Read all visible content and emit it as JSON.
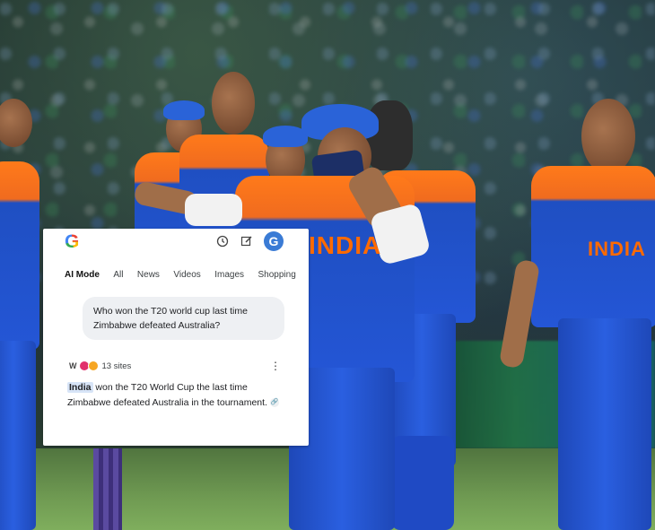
{
  "background": {
    "jersey_wordmark": "INDIA",
    "colors": {
      "jersey_orange": "#ff7a1a",
      "jersey_blue": "#2456d6",
      "pitch_green": "#6f9a52"
    }
  },
  "card": {
    "logo_icon": "google-g-logo",
    "top_icons": [
      "history-icon",
      "edit-icon"
    ],
    "avatar_letter": "G",
    "tabs": [
      "AI Mode",
      "All",
      "News",
      "Videos",
      "Images",
      "Shopping"
    ],
    "active_tab": "AI Mode",
    "query": "Who won the T20 world cup last time Zimbabwe defeated Australia?",
    "sources": {
      "count_label": "13 sites"
    },
    "answer": {
      "highlight": "India",
      "text": " won the T20 World Cup the last time Zimbabwe defeated Australia in the tournament."
    }
  }
}
